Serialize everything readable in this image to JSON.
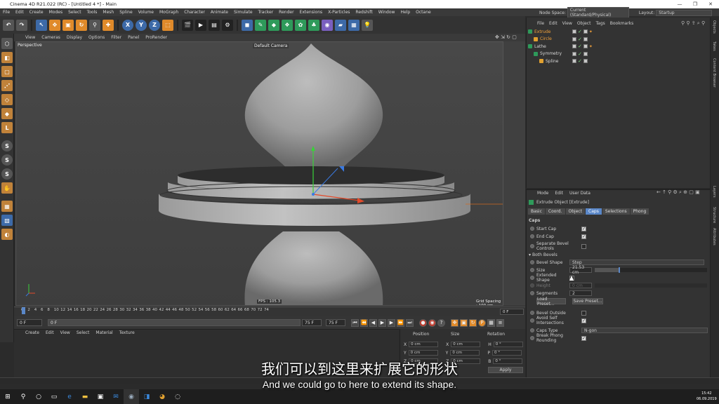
{
  "titlebar": {
    "title": "Cinema 4D R21.022 (RC) - [Untitled 4 *] - Main"
  },
  "menubar": {
    "items": [
      "File",
      "Edit",
      "Create",
      "Modes",
      "Select",
      "Tools",
      "Mesh",
      "Spline",
      "Volume",
      "MoGraph",
      "Character",
      "Animate",
      "Simulate",
      "Tracker",
      "Render",
      "Extensions",
      "X-Particles",
      "Redshift",
      "Window",
      "Help",
      "Octane"
    ],
    "node_space_label": "Node Space:",
    "node_space_value": "Current (Standard/Physical)",
    "layout_label": "Layout:",
    "layout_value": "Startup"
  },
  "viewport": {
    "menu": [
      "View",
      "Cameras",
      "Display",
      "Options",
      "Filter",
      "Panel",
      "ProRender"
    ],
    "name": "Perspective",
    "camera": "Default Camera",
    "fps": "FPS : 105.3",
    "grid_spacing": "Grid Spacing : 100 cm"
  },
  "timeline": {
    "ticks": [
      "0",
      "2",
      "4",
      "6",
      "8",
      "10",
      "12",
      "14",
      "16",
      "18",
      "20",
      "22",
      "24",
      "26",
      "28",
      "30",
      "32",
      "34",
      "36",
      "38",
      "40",
      "42",
      "44",
      "46",
      "48",
      "50",
      "52",
      "54",
      "56",
      "58",
      "60",
      "62",
      "64",
      "66",
      "68",
      "70",
      "72",
      "74"
    ],
    "current_frame": "0 F",
    "start": "0 F",
    "min": "0 F",
    "max": "75 F",
    "end": "75 F"
  },
  "material_manager": {
    "menu": [
      "Create",
      "Edit",
      "View",
      "Select",
      "Material",
      "Texture"
    ]
  },
  "coordinates": {
    "headers": [
      "Position",
      "Size",
      "Rotation"
    ],
    "rows": [
      {
        "axis": "X",
        "pos": "0 cm",
        "size_axis": "X",
        "size": "0 cm",
        "rot_axis": "H",
        "rot": "0 °"
      },
      {
        "axis": "Y",
        "pos": "0 cm",
        "size_axis": "Y",
        "size": "0 cm",
        "rot_axis": "P",
        "rot": "0 °"
      },
      {
        "axis": "Z",
        "pos": "0 cm",
        "size_axis": "Z",
        "size": "0 cm",
        "rot_axis": "B",
        "rot": "0 °"
      }
    ],
    "apply": "Apply"
  },
  "object_manager": {
    "menu": [
      "File",
      "Edit",
      "View",
      "Object",
      "Tags",
      "Bookmarks"
    ],
    "objects": [
      {
        "name": "Extrude",
        "color": "#f2a13a"
      },
      {
        "name": "Circle",
        "color": "#f2a13a"
      },
      {
        "name": "Lathe",
        "color": "#d8d8d8"
      },
      {
        "name": "Symmetry",
        "color": "#d8d8d8"
      },
      {
        "name": "Spline",
        "color": "#d8d8d8"
      }
    ]
  },
  "attributes": {
    "menu": [
      "Mode",
      "Edit",
      "User Data"
    ],
    "object_title": "Extrude Object [Extrude]",
    "tabs": [
      "Basic",
      "Coord.",
      "Object",
      "Caps",
      "Selections",
      "Phong"
    ],
    "active_tab": "Caps",
    "section": "Caps",
    "start_cap": "Start Cap",
    "end_cap": "End Cap",
    "separate_bevel": "Separate Bevel Controls",
    "both_bevels": "Both Bevels",
    "bevel_shape_label": "Bevel Shape",
    "bevel_shape_value": "Step",
    "size_label": "Size",
    "size_value": "21.53 cm",
    "extended_shape": "Extended Shape",
    "height_label": "Height",
    "height_value": "0 cm",
    "segments_label": "Segments",
    "segments_value": "2",
    "load_preset": "Load Preset...",
    "save_preset": "Save Preset...",
    "bevel_outside": "Bevel Outside",
    "avoid_self": "Avoid Self Intersections",
    "caps_type_label": "Caps Type",
    "caps_type_value": "N-gon",
    "break_phong": "Break Phong Rounding"
  },
  "side_tabs": [
    "Objects",
    "Takes",
    "Content Browser",
    "Layers",
    "Structure",
    "Attributes"
  ],
  "subtitles": {
    "zh": "我们可以到这里来扩展它的形状",
    "en": "And we could go to here to extend its shape."
  },
  "taskbar": {
    "time": "15:42",
    "date": "06.09.2019"
  }
}
